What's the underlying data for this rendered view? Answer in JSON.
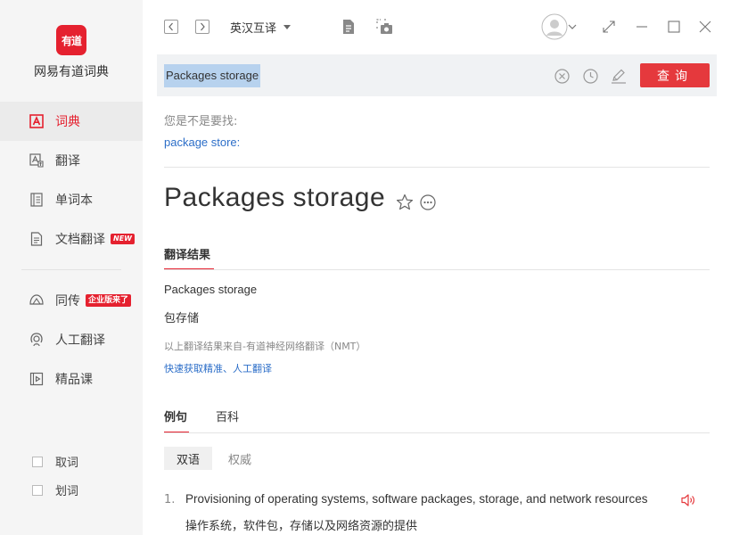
{
  "app": {
    "logo_text": "有道",
    "name": "网易有道词典",
    "brand_color": "#e5212f"
  },
  "sidebar": {
    "items": [
      {
        "label": "词典",
        "icon": "dictionary-icon",
        "active": true
      },
      {
        "label": "翻译",
        "icon": "translate-icon"
      },
      {
        "label": "单词本",
        "icon": "wordbook-icon"
      },
      {
        "label": "文档翻译",
        "icon": "document-icon",
        "badge": "NEW"
      },
      {
        "label": "同传",
        "icon": "simultaneous-icon",
        "badge": "企业版来了"
      },
      {
        "label": "人工翻译",
        "icon": "human-translate-icon"
      },
      {
        "label": "精品课",
        "icon": "course-icon"
      }
    ],
    "checks": [
      {
        "label": "取词",
        "checked": false
      },
      {
        "label": "划词",
        "checked": false
      }
    ]
  },
  "toolbar": {
    "language": "英汉互译"
  },
  "search": {
    "value": "Packages storage",
    "button_label": "查询"
  },
  "suggestion": {
    "label": "您是不是要找:",
    "link": "package store:"
  },
  "entry": {
    "headword": "Packages storage"
  },
  "result_tabs": {
    "translation": "翻译结果"
  },
  "translation": {
    "en": "Packages storage",
    "zh": "包存储",
    "note": "以上翻译结果来自-有道神经网络翻译（NMT）",
    "link": "快速获取精准、人工翻译"
  },
  "example_tabs": {
    "sentences": "例句",
    "encyclopedia": "百科"
  },
  "example_subtabs": {
    "bilingual": "双语",
    "authoritative": "权威"
  },
  "examples": [
    {
      "num": "1.",
      "en": "Provisioning of operating systems, software packages, storage, and network resources",
      "zh": "操作系统，软件包，存储以及网络资源的提供"
    }
  ]
}
